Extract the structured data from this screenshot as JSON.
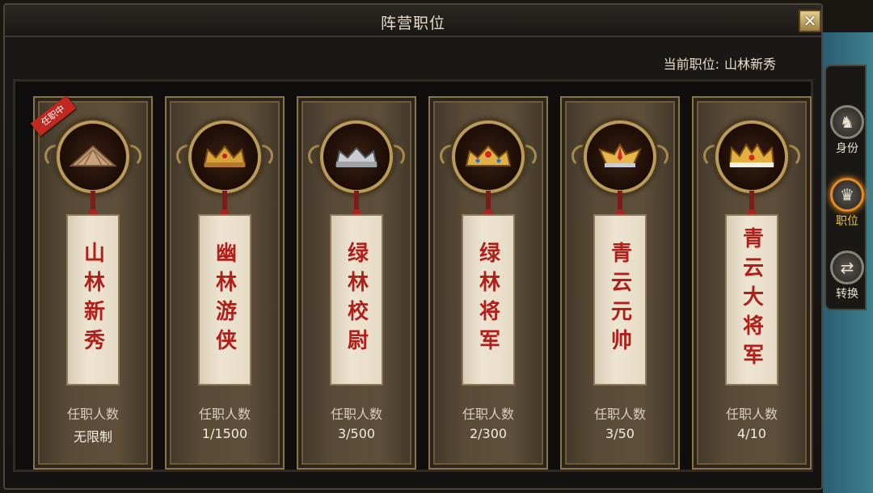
{
  "window": {
    "title": "阵营职位",
    "close_icon": "✕"
  },
  "current": {
    "label": "当前职位:",
    "value": "山林新秀"
  },
  "badge_text": "任职中",
  "count_label": "任职人数",
  "cards": [
    {
      "name": "山林新秀",
      "count": "无限制",
      "helmet": "straw-hat-icon"
    },
    {
      "name": "幽林游侠",
      "count": "1/1500",
      "helmet": "gold-crown-icon"
    },
    {
      "name": "绿林校尉",
      "count": "3/500",
      "helmet": "silver-crown-icon"
    },
    {
      "name": "绿林将军",
      "count": "2/300",
      "helmet": "jeweled-crown-icon"
    },
    {
      "name": "青云元帅",
      "count": "3/50",
      "helmet": "winged-crown-icon"
    },
    {
      "name": "青云大将军",
      "count": "4/10",
      "helmet": "grand-crown-icon"
    }
  ],
  "sidebar": [
    {
      "label": "身份",
      "icon": "identity-icon"
    },
    {
      "label": "职位",
      "icon": "position-icon"
    },
    {
      "label": "转换",
      "icon": "switch-icon"
    }
  ],
  "colors": {
    "scroll_text": "#b01f1a",
    "badge": "#c1281f",
    "active": "#e98a1f"
  }
}
